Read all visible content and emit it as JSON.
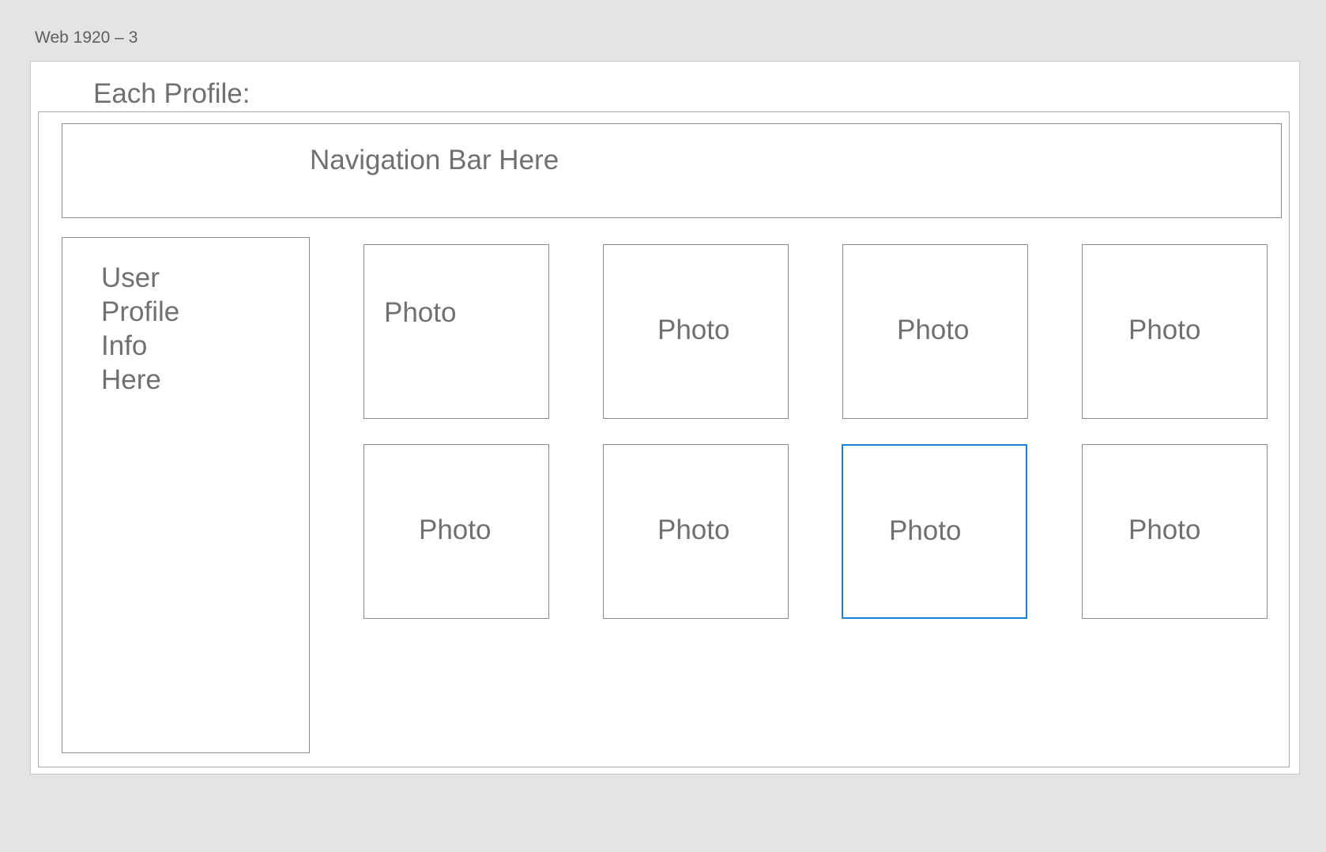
{
  "artboard": {
    "label": "Web 1920 – 3"
  },
  "section_title": "Each Profile:",
  "nav_bar": {
    "label": "Navigation Bar Here"
  },
  "profile_panel": {
    "lines": [
      "User",
      "Profile",
      "Info",
      "Here"
    ]
  },
  "photos": [
    {
      "label": "Photo",
      "selected": false
    },
    {
      "label": "Photo",
      "selected": false
    },
    {
      "label": "Photo",
      "selected": false
    },
    {
      "label": "Photo",
      "selected": false
    },
    {
      "label": "Photo",
      "selected": false
    },
    {
      "label": "Photo",
      "selected": false
    },
    {
      "label": "Photo",
      "selected": true
    },
    {
      "label": "Photo",
      "selected": false
    }
  ],
  "colors": {
    "canvas_background": "#e4e4e4",
    "artboard_background": "#ffffff",
    "wireframe_stroke": "#8c8c8c",
    "text": "#707070",
    "selection": "#1a82d6"
  }
}
